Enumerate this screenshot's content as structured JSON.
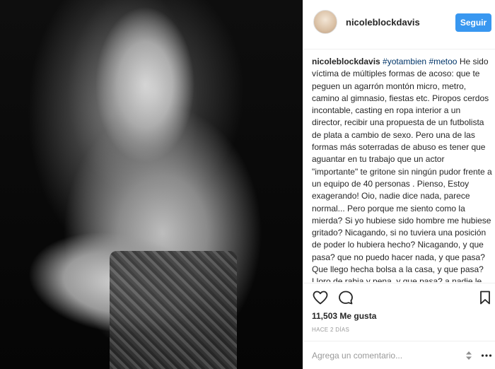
{
  "post": {
    "username": "nicoleblockdavis",
    "follow_label": "Seguir",
    "caption_user": "nicoleblockdavis",
    "hashtags": [
      "#yotambien",
      "#metoo"
    ],
    "caption_text": "He sido víctima de múltiples formas de acoso: que te peguen un agarrón montón micro, metro, camino al gimnasio, fiestas etc. Piropos cerdos incontable, casting en ropa interior a un director, recibir una propuesta de un futbolista de plata a cambio de sexo. Pero una de las formas más soterradas de abuso es tener que aguantar en tu trabajo que un actor \"importante\" te gritone sin ningún pudor frente a un equipo de 40 personas . Pienso, Estoy exagerando! Oio, nadie dice nada, parece normal... Pero porque me siento como la mierda? Si yo hubiese sido hombre me hubiese gritado? Nicagando, si no tuviera una posición de poder lo hubiera hecho? Nicagando, y que pasa? que no puedo hacer nada, y que pasa? Que llego hecha bolsa a la casa, y que pasa? Lloro de rabia y pena, y que pasa? a nadie le importa nada",
    "likes": "11,503 Me gusta",
    "time_ago": "HACE 2 DÍAS",
    "comment_placeholder": "Agrega un comentario..."
  },
  "icons": {
    "like": "heart-outline-icon",
    "comment": "speech-bubble-icon",
    "save": "bookmark-icon",
    "stepper": "up-down-arrows-icon",
    "more": "ellipsis-icon"
  },
  "colors": {
    "follow_button": "#3897f0",
    "hashtag": "#003569",
    "muted": "#999999",
    "text": "#262626"
  }
}
